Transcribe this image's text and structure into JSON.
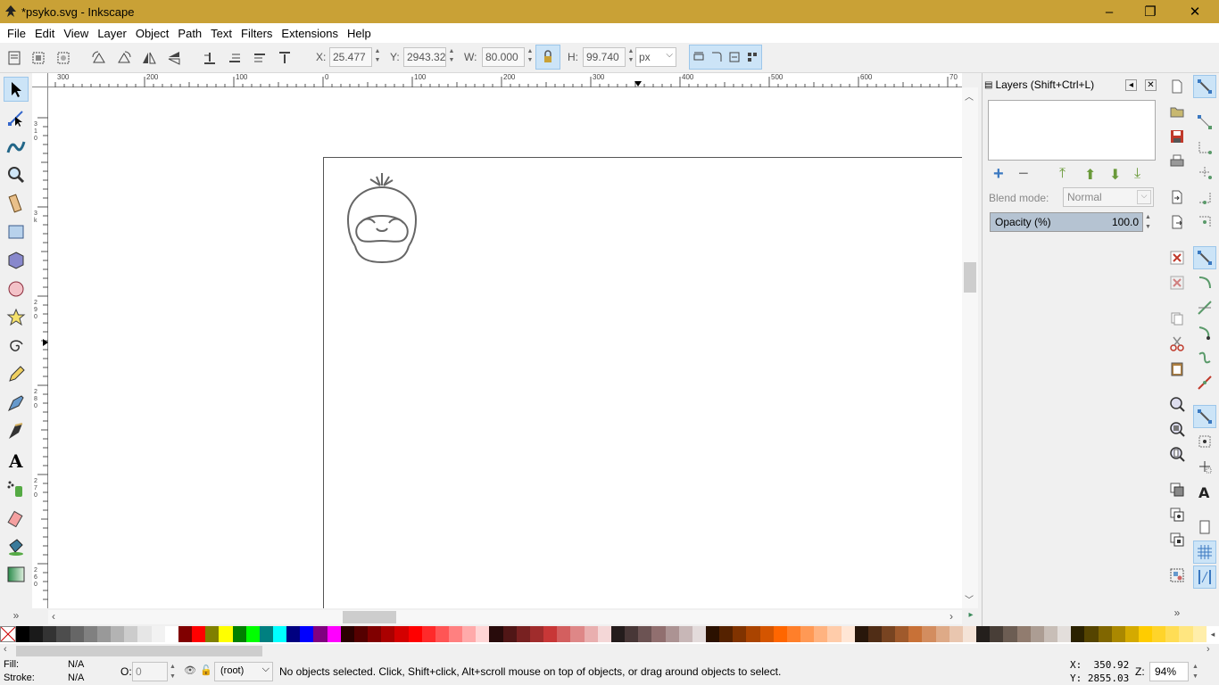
{
  "window": {
    "title": "*psyko.svg - Inkscape",
    "minimize": "–",
    "maximize": "❐",
    "close": "✕"
  },
  "menu": [
    "File",
    "Edit",
    "View",
    "Layer",
    "Object",
    "Path",
    "Text",
    "Filters",
    "Extensions",
    "Help"
  ],
  "toolbar": {
    "x_label": "X:",
    "x_value": "25.477",
    "y_label": "Y:",
    "y_value": "2943.32",
    "w_label": "W:",
    "w_value": "80.000",
    "h_label": "H:",
    "h_value": "99.740",
    "unit": "px"
  },
  "ruler": {
    "h_ticks": [
      "300",
      "200",
      "100",
      "0",
      "100",
      "200",
      "300",
      "400",
      "500",
      "600",
      "70"
    ],
    "v_ticks": [
      "310",
      "3k",
      "290",
      "280",
      "270",
      "260"
    ]
  },
  "layers_panel": {
    "title": "Layers (Shift+Ctrl+L)",
    "blend_label": "Blend mode:",
    "blend_value": "Normal",
    "opacity_label": "Opacity (%)",
    "opacity_value": "100.0"
  },
  "palette_colors": [
    "#000000",
    "#1a1a1a",
    "#333333",
    "#4d4d4d",
    "#666666",
    "#808080",
    "#999999",
    "#b3b3b3",
    "#cccccc",
    "#e6e6e6",
    "#f2f2f2",
    "#ffffff",
    "#800000",
    "#ff0000",
    "#808000",
    "#ffff00",
    "#008000",
    "#00ff00",
    "#008080",
    "#00ffff",
    "#000080",
    "#0000ff",
    "#800080",
    "#ff00ff",
    "#2b0000",
    "#550000",
    "#800000",
    "#aa0000",
    "#d40000",
    "#ff0000",
    "#ff2a2a",
    "#ff5555",
    "#ff8080",
    "#ffaaaa",
    "#ffd5d5",
    "#280b0b",
    "#501616",
    "#782121",
    "#a02c2c",
    "#c83737",
    "#d35f5f",
    "#de8787",
    "#e9afaf",
    "#f4d7d7",
    "#241c1c",
    "#483737",
    "#6c5353",
    "#916f6f",
    "#ac9393",
    "#c8b7b7",
    "#e3dbdb",
    "#2b1100",
    "#552200",
    "#803300",
    "#aa4400",
    "#d45500",
    "#ff6600",
    "#ff7f2a",
    "#ff9955",
    "#ffb380",
    "#ffccaa",
    "#ffe6d5",
    "#28170b",
    "#502d16",
    "#784421",
    "#a05a2c",
    "#c87137",
    "#d38d5f",
    "#deaa87",
    "#e9c6af",
    "#f4e3d7",
    "#241f1c",
    "#483e37",
    "#6c5d53",
    "#917c6f",
    "#ac9d93",
    "#c8beb7",
    "#e3dedb",
    "#2b2200",
    "#554400",
    "#806600",
    "#aa8800",
    "#d4aa00",
    "#ffcc00",
    "#ffd42a",
    "#ffdd55",
    "#ffe680",
    "#ffeeaa"
  ],
  "status": {
    "fill_label": "Fill:",
    "fill_value": "N/A",
    "stroke_label": "Stroke:",
    "stroke_value": "N/A",
    "opacity_label": "O:",
    "opacity_value": "0",
    "layer_value": "(root)",
    "message": "No objects selected. Click, Shift+click, Alt+scroll mouse on top of objects, or drag around objects to select.",
    "x_coord": "X:  350.92",
    "y_coord": "Y: 2855.03",
    "zoom_label": "Z:",
    "zoom_value": "94%"
  },
  "colors": {
    "titlebar": "#c9a136",
    "selected": "#cce4f7",
    "canvas": "#ffffff"
  }
}
